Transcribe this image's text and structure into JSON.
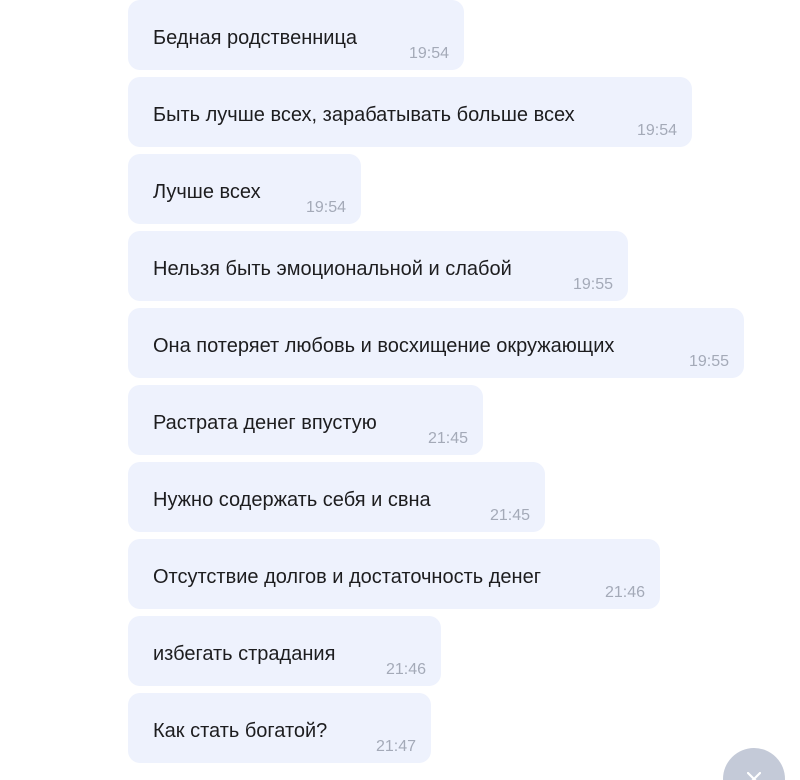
{
  "messages": [
    {
      "text": "Бедная родственница",
      "time": "19:54"
    },
    {
      "text": "Быть лучше всех, зарабатывать больше всех",
      "time": "19:54"
    },
    {
      "text": "Лучше всех",
      "time": "19:54"
    },
    {
      "text": "Нельзя быть эмоциональной и слабой",
      "time": "19:55"
    },
    {
      "text": "Она потеряет любовь и восхищение окружающих",
      "time": "19:55"
    },
    {
      "text": "Растрата денег впустую",
      "time": "21:45"
    },
    {
      "text": "Нужно содержать себя и свна",
      "time": "21:45"
    },
    {
      "text": "Отсутствие долгов и достаточность денег",
      "time": "21:46"
    },
    {
      "text": "избегать страдания",
      "time": "21:46"
    },
    {
      "text": "Как стать богатой?",
      "time": "21:47"
    }
  ],
  "colors": {
    "bubble_bg": "#eef2fd",
    "message_text": "#1d1d1f",
    "timestamp": "#a4aab8",
    "fab_bg": "#c4cad8"
  },
  "icons": {
    "fab": "close-icon"
  }
}
